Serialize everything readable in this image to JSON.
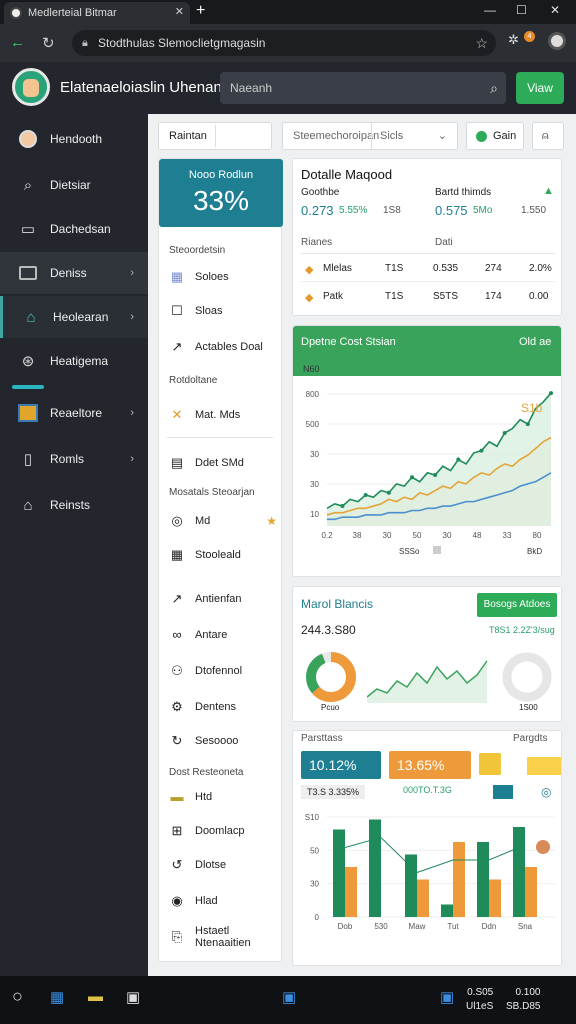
{
  "browser": {
    "tab_title": "Medlerteial Bitmar",
    "url": "Stodthulas Slemoclietgmagasin"
  },
  "app": {
    "title": "Elatenaeloiaslin Uhenanaa",
    "search_placeholder": "Naeanh",
    "view_label": "Viaw"
  },
  "sidebar": {
    "items": [
      {
        "label": "Hendooth",
        "icon": "avatar-icon"
      },
      {
        "label": "Dietsiar",
        "icon": "search-icon"
      },
      {
        "label": "Dachedsan",
        "icon": "document-icon"
      },
      {
        "label": "Deniss",
        "icon": "folder-icon"
      },
      {
        "label": "Heolearan",
        "icon": "building-icon"
      },
      {
        "label": "Heatigema",
        "icon": "chart-icon"
      },
      {
        "label": "Reaeltore",
        "icon": "image-icon"
      },
      {
        "label": "Romls",
        "icon": "clipboard-icon"
      },
      {
        "label": "Reinsts",
        "icon": "home-icon"
      }
    ]
  },
  "toolbar": {
    "field1": "Raintan",
    "field2": "Steemechoroipan",
    "field3": "Sicls",
    "gain_label": "Gain"
  },
  "leftcol": {
    "stat_label": "Nooo Rodlun",
    "stat_value": "33%",
    "head1": "Steoordetsin",
    "items1": [
      "Soloes",
      "Sloas",
      "Actables Doal"
    ],
    "head2": "Rotdoltane",
    "items2": [
      "Mat. Mds"
    ],
    "items3": [
      "Ddet SMd"
    ],
    "head3": "Mosatals Steoarjan",
    "items4": [
      "Md",
      "Stooleald",
      "Antienfan",
      "Antare",
      "Dtofennol",
      "Dentens",
      "Sesoooo"
    ],
    "head4": "Dost Resteoneta",
    "items5": [
      "Htd",
      "Doomlacp",
      "Dlotse",
      "Hlad"
    ],
    "footer": [
      "Hstaetl",
      "Ntenaaitien"
    ]
  },
  "section1": {
    "title": "Dotalle Maqood",
    "col1_label": "Goothbe",
    "col1_value": "0.273",
    "col1_pct": "5.55%",
    "col1_extra": "1S8",
    "col2_label": "Bartd thimds",
    "col2_value": "0.575",
    "col2_pct": "5Mo",
    "col2_extra": "1.550",
    "table_head1": "Rianes",
    "table_head2": "Dati",
    "rows": [
      {
        "name": "Mlelas",
        "a": "T1S",
        "b": "0.535",
        "c": "274",
        "d": "2.0%"
      },
      {
        "name": "Patk",
        "a": "T1S",
        "b": "S5TS",
        "c": "174",
        "d": "0.00"
      }
    ]
  },
  "section2": {
    "title": "Dpetne Cost Stsian",
    "right_label": "Old ae",
    "annot1": "N60",
    "annot2": "S1b",
    "y_ticks": [
      "800",
      "500",
      "30",
      "30",
      "10"
    ],
    "x_ticks": [
      "0.2",
      "38",
      "30",
      "50",
      "30",
      "48",
      "33",
      "80"
    ],
    "x_label": "SSSo",
    "x_label2": "BkD"
  },
  "section3": {
    "title": "Marol Blancis",
    "button": "Bosogs Atdoes",
    "value_left": "244.3.S80",
    "value_right": "T8S1 2.2Z'3/sug",
    "sub1": "Pcuo",
    "sub2": "1S00"
  },
  "section4": {
    "head_left": "Parsttass",
    "head_right": "Pargdts",
    "pill1": "10.12%",
    "pill2": "13.65%",
    "sub1": "T3.S 3.335%",
    "sub2": "000TO.T.3G",
    "x_ticks": [
      "Dob",
      "530",
      "Maw",
      "Tut",
      "Ddn",
      "Sna"
    ],
    "y_ticks": [
      "S10",
      "50",
      "30",
      "0"
    ]
  },
  "taskbar": {
    "time1": "0.S05",
    "time2": "0.100",
    "date1": "Ul1eS",
    "date2": "SB.D85"
  },
  "colors": {
    "accent_green": "#3aa35b",
    "accent_teal": "#1f7f92",
    "accent_orange": "#ef9a3a",
    "sidebar_bg": "#23272d"
  },
  "chart_data": [
    {
      "type": "line",
      "x": [
        1,
        2,
        3,
        4,
        5,
        6,
        7,
        8,
        9,
        10,
        11,
        12,
        13,
        14,
        15,
        16,
        17,
        18,
        19,
        20,
        21,
        22,
        23,
        24,
        25,
        26,
        27,
        28,
        29,
        30
      ],
      "series": [
        {
          "values": [
            8,
            10,
            9,
            12,
            11,
            14,
            13,
            16,
            15,
            19,
            18,
            22,
            20,
            24,
            23,
            27,
            25,
            30,
            28,
            33,
            34,
            38,
            36,
            42,
            44,
            48,
            46,
            53,
            56,
            60
          ]
        },
        {
          "values": [
            5,
            6,
            6,
            7,
            8,
            8,
            9,
            10,
            12,
            11,
            13,
            12,
            15,
            14,
            16,
            18,
            17,
            20,
            19,
            22,
            24,
            23,
            26,
            28,
            27,
            30,
            32,
            35,
            38,
            40
          ]
        },
        {
          "values": [
            3,
            3,
            4,
            4,
            4,
            5,
            5,
            5,
            6,
            6,
            6,
            7,
            7,
            8,
            8,
            9,
            9,
            10,
            11,
            11,
            12,
            13,
            14,
            15,
            16,
            18,
            19,
            20,
            22,
            24
          ]
        }
      ]
    },
    {
      "type": "bar",
      "categories": [
        "Dob",
        "530",
        "Maw",
        "Tut",
        "Ddn",
        "Sna"
      ],
      "series": [
        {
          "values": [
            70,
            78,
            50,
            10,
            60,
            72
          ]
        },
        {
          "values": [
            40,
            0,
            30,
            60,
            30,
            40
          ]
        }
      ]
    }
  ]
}
